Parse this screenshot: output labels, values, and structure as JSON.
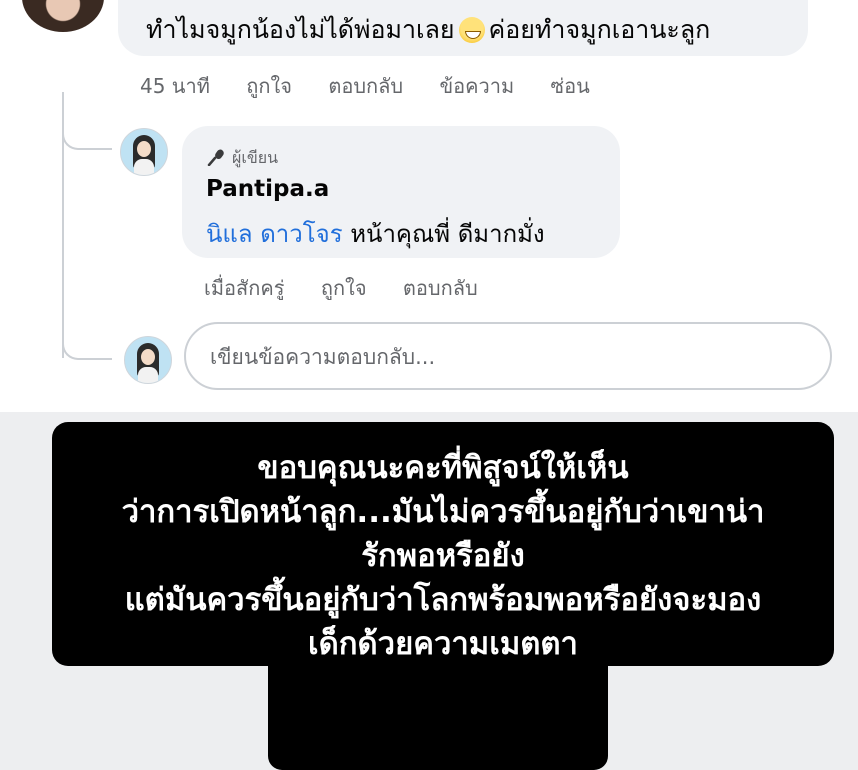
{
  "comment": {
    "text_before_emoji": "ทำไมจมูกน้องไม่ได้พ่อมาเลย",
    "emoji": "grinning-sweat-emoji",
    "text_after_emoji": "ค่อยทำจมูกเอานะลูก",
    "actions": [
      "45 นาที",
      "ถูกใจ",
      "ตอบกลับ",
      "ข้อความ",
      "ซ่อน"
    ]
  },
  "reply": {
    "badge": "ผู้เขียน",
    "author": "Pantipa.a",
    "mention": "นิแล ดาวโจร",
    "text": " หน้าคุณพี่ ดีมากมั่ง",
    "actions": [
      "เมื่อสักครู่",
      "ถูกใจ",
      "ตอบกลับ"
    ]
  },
  "reply_input": {
    "placeholder": "เขียนข้อความตอบกลับ...",
    "value": ""
  },
  "caption": {
    "lines": [
      "ขอบคุณนะคะที่พิสูจน์ให้เห็น",
      "ว่าการเปิดหน้าลูก...มันไม่ควรขึ้นอยู่กับว่าเขาน่า",
      "รักพอหรือยัง",
      "แต่มันควรขึ้นอยู่กับว่าโลกพร้อมพอหรือยังจะมอง",
      "เด็กด้วยความเมตตา"
    ]
  },
  "colors": {
    "bubble": "#f0f2f5",
    "link": "#216fdb",
    "muted": "#65676b",
    "caption_bg": "#000000",
    "caption_text": "#ffffff",
    "bottom_bg": "#edeef0"
  }
}
